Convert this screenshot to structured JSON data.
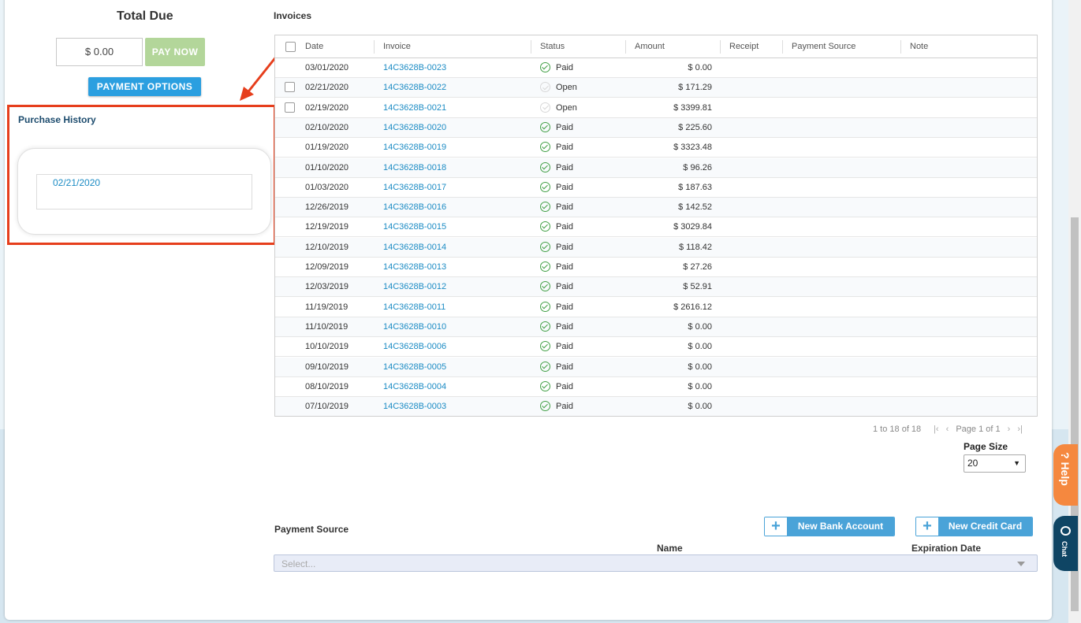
{
  "left": {
    "total_due_label": "Total Due",
    "amount_value": "$ 0.00",
    "pay_now_label": "PAY NOW",
    "payment_options_label": "PAYMENT OPTIONS",
    "purchase_history_title": "Purchase History",
    "purchase_history_dates": [
      "02/21/2020"
    ]
  },
  "invoices": {
    "title": "Invoices",
    "columns": [
      "Date",
      "Invoice",
      "Status",
      "Amount",
      "Receipt",
      "Payment Source",
      "Note"
    ],
    "rows": [
      {
        "date": "03/01/2020",
        "invoice": "14C3628B-0023",
        "status": "Paid",
        "amount": "$ 0.00",
        "checkbox": false
      },
      {
        "date": "02/21/2020",
        "invoice": "14C3628B-0022",
        "status": "Open",
        "amount": "$ 171.29",
        "checkbox": true
      },
      {
        "date": "02/19/2020",
        "invoice": "14C3628B-0021",
        "status": "Open",
        "amount": "$ 3399.81",
        "checkbox": true
      },
      {
        "date": "02/10/2020",
        "invoice": "14C3628B-0020",
        "status": "Paid",
        "amount": "$ 225.60",
        "checkbox": false
      },
      {
        "date": "01/19/2020",
        "invoice": "14C3628B-0019",
        "status": "Paid",
        "amount": "$ 3323.48",
        "checkbox": false
      },
      {
        "date": "01/10/2020",
        "invoice": "14C3628B-0018",
        "status": "Paid",
        "amount": "$ 96.26",
        "checkbox": false
      },
      {
        "date": "01/03/2020",
        "invoice": "14C3628B-0017",
        "status": "Paid",
        "amount": "$ 187.63",
        "checkbox": false
      },
      {
        "date": "12/26/2019",
        "invoice": "14C3628B-0016",
        "status": "Paid",
        "amount": "$ 142.52",
        "checkbox": false
      },
      {
        "date": "12/19/2019",
        "invoice": "14C3628B-0015",
        "status": "Paid",
        "amount": "$ 3029.84",
        "checkbox": false
      },
      {
        "date": "12/10/2019",
        "invoice": "14C3628B-0014",
        "status": "Paid",
        "amount": "$ 118.42",
        "checkbox": false
      },
      {
        "date": "12/09/2019",
        "invoice": "14C3628B-0013",
        "status": "Paid",
        "amount": "$ 27.26",
        "checkbox": false
      },
      {
        "date": "12/03/2019",
        "invoice": "14C3628B-0012",
        "status": "Paid",
        "amount": "$ 52.91",
        "checkbox": false
      },
      {
        "date": "11/19/2019",
        "invoice": "14C3628B-0011",
        "status": "Paid",
        "amount": "$ 2616.12",
        "checkbox": false
      },
      {
        "date": "11/10/2019",
        "invoice": "14C3628B-0010",
        "status": "Paid",
        "amount": "$ 0.00",
        "checkbox": false
      },
      {
        "date": "10/10/2019",
        "invoice": "14C3628B-0006",
        "status": "Paid",
        "amount": "$ 0.00",
        "checkbox": false
      },
      {
        "date": "09/10/2019",
        "invoice": "14C3628B-0005",
        "status": "Paid",
        "amount": "$ 0.00",
        "checkbox": false
      },
      {
        "date": "08/10/2019",
        "invoice": "14C3628B-0004",
        "status": "Paid",
        "amount": "$ 0.00",
        "checkbox": false
      },
      {
        "date": "07/10/2019",
        "invoice": "14C3628B-0003",
        "status": "Paid",
        "amount": "$ 0.00",
        "checkbox": false
      }
    ],
    "pager": {
      "range": "1 to 18 of 18",
      "page": "Page 1 of 1",
      "page_size_label": "Page Size",
      "page_size_value": "20"
    }
  },
  "payment_source": {
    "title": "Payment Source",
    "new_bank_label": "New Bank Account",
    "new_card_label": "New Credit Card",
    "name_header": "Name",
    "expiration_header": "Expiration Date",
    "select_placeholder": "Select..."
  },
  "side_tabs": {
    "help_label": "? Help",
    "chat_label": "Chat"
  },
  "colors": {
    "accent_blue": "#2b9fe0",
    "link_blue": "#1b8bc4",
    "paid_green": "#43a047",
    "annotation_red": "#e63e1c",
    "help_orange": "#f5883f",
    "chat_navy": "#0f4564"
  }
}
